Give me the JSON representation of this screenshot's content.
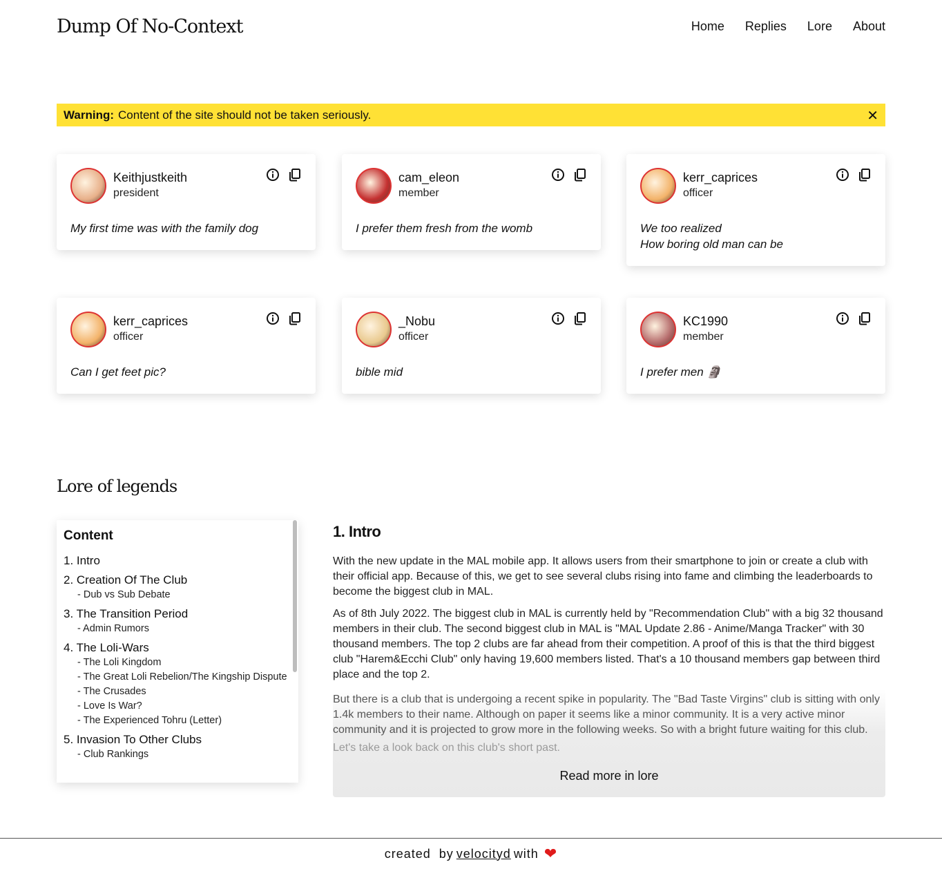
{
  "site": {
    "title": "Dump Of No-Context"
  },
  "nav": {
    "items": [
      "Home",
      "Replies",
      "Lore",
      "About"
    ]
  },
  "warning": {
    "label": "Warning:",
    "text": "Content of the site should not be taken seriously.",
    "close": "✕"
  },
  "cards": [
    {
      "name": "Keithjustkeith",
      "role": "president",
      "quote": "My first time was with the family dog",
      "avatar_color": "#e8b08a"
    },
    {
      "name": "cam_eleon",
      "role": "member",
      "quote": "I prefer them fresh from the womb",
      "avatar_color": "#c43131"
    },
    {
      "name": "kerr_caprices",
      "role": "officer",
      "quote": "We too realized\nHow boring old man can be",
      "avatar_color": "#f3b36a"
    },
    {
      "name": "kerr_caprices",
      "role": "officer",
      "quote": "Can I get feet pic?",
      "avatar_color": "#f3b36a"
    },
    {
      "name": "_Nobu",
      "role": "officer",
      "quote": "bible mid",
      "avatar_color": "#e9c98e"
    },
    {
      "name": "KC1990",
      "role": "member",
      "quote": "I prefer men 🗿",
      "avatar_color": "#b56b6b"
    }
  ],
  "lore": {
    "title": "Lore of legends",
    "toc_title": "Content",
    "toc": [
      {
        "label": "1. Intro",
        "subs": []
      },
      {
        "label": "2. Creation Of The Club",
        "subs": [
          "- Dub vs Sub Debate"
        ]
      },
      {
        "label": "3. The Transition Period",
        "subs": [
          "- Admin Rumors"
        ]
      },
      {
        "label": "4. The Loli-Wars",
        "subs": [
          "- The Loli Kingdom",
          "- The Great Loli Rebelion/The Kingship Dispute",
          "- The Crusades",
          "- Love Is War?",
          "- The Experienced Tohru (Letter)"
        ]
      },
      {
        "label": "5. Invasion To Other Clubs",
        "subs": [
          "- Club Rankings"
        ]
      }
    ],
    "article_title": "1. Intro",
    "paragraphs": [
      "With the new update in the MAL mobile app. It allows users from their smartphone to join or create a club with their official app. Because of this, we get to see several clubs rising into fame and climbing the leaderboards to become the biggest club in MAL.",
      "As of 8th July 2022. The biggest club in MAL is currently held by \"Recommendation Club\" with a big 32 thousand members in their club. The second biggest club in MAL is \"MAL Update 2.86 - Anime/Manga Tracker\" with 30 thousand members. The top 2 clubs are far ahead from their competition. A proof of this is that the third biggest club \"Harem&Ecchi Club\" only having 19,600 members listed. That's a 10 thousand members gap between third place and the top 2.",
      "But there is a club that is undergoing a recent spike in popularity. The \"Bad Taste Virgins\" club is sitting with only 1.4k members to their name. Although on paper it seems like a minor community. It is a very active minor community and it is projected to grow more in the following weeks. So with a bright future waiting for this club.",
      "Let's take a look back on this club's short past."
    ],
    "read_more": "Read more in lore"
  },
  "footer": {
    "prefix": "created by",
    "author": "velocityd",
    "suffix": "with",
    "heart": "❤"
  }
}
